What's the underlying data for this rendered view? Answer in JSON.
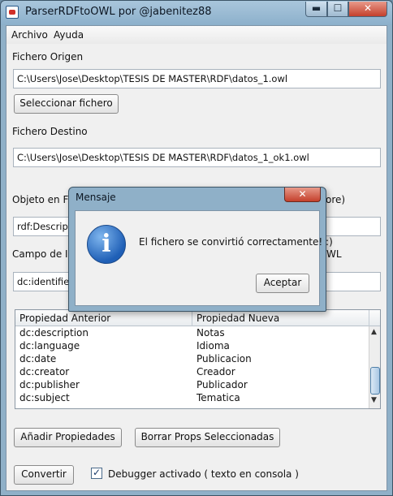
{
  "window": {
    "title": "ParserRDFtoOWL por @jabenitez88",
    "min_glyph": "▬",
    "max_glyph": "☐",
    "close_glyph": "✕"
  },
  "menu": {
    "items": [
      "Archivo",
      "Ayuda"
    ]
  },
  "form": {
    "origen_label": "Fichero Origen",
    "origen_value": "C:\\Users\\Jose\\Desktop\\TESIS DE MASTER\\RDF\\datos_1.owl",
    "select_button": "Seleccionar fichero",
    "destino_label": "Fichero Destino",
    "destino_value": "C:\\Users\\Jose\\Desktop\\TESIS DE MASTER\\RDF\\datos_1_ok1.owl",
    "objeto_label_left": "Objeto en Fic",
    "objeto_label_right": "ore)",
    "objeto_value": "rdf:Descript",
    "campo_label_left": "Campo de ID",
    "campo_label_right": "WL",
    "campo_value": "dc:identifier"
  },
  "table": {
    "columns": [
      "Propiedad Anterior",
      "Propiedad Nueva"
    ],
    "rows": [
      [
        "dc:description",
        "Notas"
      ],
      [
        "dc:language",
        "Idioma"
      ],
      [
        "dc:date",
        "Publicacion"
      ],
      [
        "dc:creator",
        "Creador"
      ],
      [
        "dc:publisher",
        "Publicador"
      ],
      [
        "dc:subject",
        "Tematica"
      ]
    ]
  },
  "buttons": {
    "add_props": "Añadir Propiedades",
    "delete_props": "Borrar Props Seleccionadas",
    "convert": "Convertir"
  },
  "debugger": {
    "checked": true,
    "label": "Debugger activado ( texto en consola )"
  },
  "dialog": {
    "title": "Mensaje",
    "message": "El fichero se convirtió correctamente! :)",
    "ok_button": "Aceptar",
    "icon_glyph": "i"
  },
  "icons": {
    "app": "app-java-icon",
    "dialog": "info-icon",
    "check": "check-icon"
  }
}
